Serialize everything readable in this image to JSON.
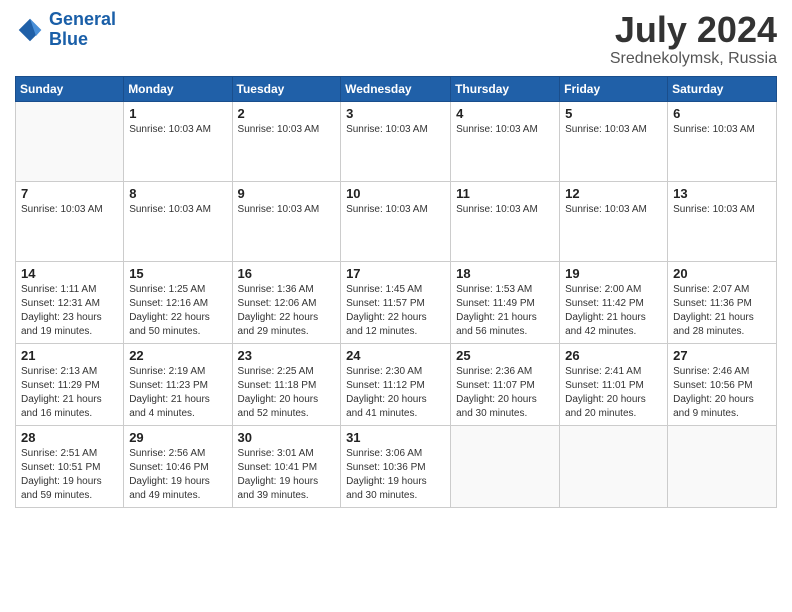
{
  "logo": {
    "line1": "General",
    "line2": "Blue"
  },
  "title": "July 2024",
  "location": "Srednekolymsk, Russia",
  "weekdays": [
    "Sunday",
    "Monday",
    "Tuesday",
    "Wednesday",
    "Thursday",
    "Friday",
    "Saturday"
  ],
  "weeks": [
    [
      {
        "day": "",
        "info": ""
      },
      {
        "day": "1",
        "info": "Sunrise: 10:03 AM"
      },
      {
        "day": "2",
        "info": "Sunrise: 10:03 AM"
      },
      {
        "day": "3",
        "info": "Sunrise: 10:03 AM"
      },
      {
        "day": "4",
        "info": "Sunrise: 10:03 AM"
      },
      {
        "day": "5",
        "info": "Sunrise: 10:03 AM"
      },
      {
        "day": "6",
        "info": "Sunrise: 10:03 AM"
      }
    ],
    [
      {
        "day": "7",
        "info": "Sunrise: 10:03 AM"
      },
      {
        "day": "8",
        "info": "Sunrise: 10:03 AM"
      },
      {
        "day": "9",
        "info": "Sunrise: 10:03 AM"
      },
      {
        "day": "10",
        "info": "Sunrise: 10:03 AM"
      },
      {
        "day": "11",
        "info": "Sunrise: 10:03 AM"
      },
      {
        "day": "12",
        "info": "Sunrise: 10:03 AM"
      },
      {
        "day": "13",
        "info": "Sunrise: 10:03 AM"
      }
    ],
    [
      {
        "day": "14",
        "info": "Sunrise: 1:11 AM\nSunset: 12:31 AM\nDaylight: 23 hours and 19 minutes."
      },
      {
        "day": "15",
        "info": "Sunrise: 1:25 AM\nSunset: 12:16 AM\nDaylight: 22 hours and 50 minutes."
      },
      {
        "day": "16",
        "info": "Sunrise: 1:36 AM\nSunset: 12:06 AM\nDaylight: 22 hours and 29 minutes."
      },
      {
        "day": "17",
        "info": "Sunrise: 1:45 AM\nSunset: 11:57 PM\nDaylight: 22 hours and 12 minutes."
      },
      {
        "day": "18",
        "info": "Sunrise: 1:53 AM\nSunset: 11:49 PM\nDaylight: 21 hours and 56 minutes."
      },
      {
        "day": "19",
        "info": "Sunrise: 2:00 AM\nSunset: 11:42 PM\nDaylight: 21 hours and 42 minutes."
      },
      {
        "day": "20",
        "info": "Sunrise: 2:07 AM\nSunset: 11:36 PM\nDaylight: 21 hours and 28 minutes."
      }
    ],
    [
      {
        "day": "21",
        "info": "Sunrise: 2:13 AM\nSunset: 11:29 PM\nDaylight: 21 hours and 16 minutes."
      },
      {
        "day": "22",
        "info": "Sunrise: 2:19 AM\nSunset: 11:23 PM\nDaylight: 21 hours and 4 minutes."
      },
      {
        "day": "23",
        "info": "Sunrise: 2:25 AM\nSunset: 11:18 PM\nDaylight: 20 hours and 52 minutes."
      },
      {
        "day": "24",
        "info": "Sunrise: 2:30 AM\nSunset: 11:12 PM\nDaylight: 20 hours and 41 minutes."
      },
      {
        "day": "25",
        "info": "Sunrise: 2:36 AM\nSunset: 11:07 PM\nDaylight: 20 hours and 30 minutes."
      },
      {
        "day": "26",
        "info": "Sunrise: 2:41 AM\nSunset: 11:01 PM\nDaylight: 20 hours and 20 minutes."
      },
      {
        "day": "27",
        "info": "Sunrise: 2:46 AM\nSunset: 10:56 PM\nDaylight: 20 hours and 9 minutes."
      }
    ],
    [
      {
        "day": "28",
        "info": "Sunrise: 2:51 AM\nSunset: 10:51 PM\nDaylight: 19 hours and 59 minutes."
      },
      {
        "day": "29",
        "info": "Sunrise: 2:56 AM\nSunset: 10:46 PM\nDaylight: 19 hours and 49 minutes."
      },
      {
        "day": "30",
        "info": "Sunrise: 3:01 AM\nSunset: 10:41 PM\nDaylight: 19 hours and 39 minutes."
      },
      {
        "day": "31",
        "info": "Sunrise: 3:06 AM\nSunset: 10:36 PM\nDaylight: 19 hours and 30 minutes."
      },
      {
        "day": "",
        "info": ""
      },
      {
        "day": "",
        "info": ""
      },
      {
        "day": "",
        "info": ""
      }
    ]
  ]
}
